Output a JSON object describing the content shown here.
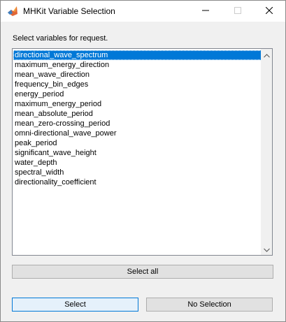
{
  "window": {
    "title": "MHKit Variable Selection"
  },
  "prompt": "Select variables for request.",
  "variables": {
    "items": [
      "directional_wave_spectrum",
      "maximum_energy_direction",
      "mean_wave_direction",
      "frequency_bin_edges",
      "energy_period",
      "maximum_energy_period",
      "mean_absolute_period",
      "mean_zero-crossing_period",
      "omni-directional_wave_power",
      "peak_period",
      "significant_wave_height",
      "water_depth",
      "spectral_width",
      "directionality_coefficient"
    ],
    "selected_index": 0
  },
  "buttons": {
    "select_all": "Select all",
    "select": "Select",
    "no_selection": "No Selection"
  },
  "icons": {
    "app": "matlab-icon",
    "minimize": "minimize-icon",
    "maximize": "maximize-icon",
    "close": "close-icon",
    "scroll_up": "scroll-up-arrow-icon",
    "scroll_down": "scroll-down-arrow-icon"
  },
  "colors": {
    "selection": "#0078d7",
    "default_button_border": "#0078d7"
  }
}
